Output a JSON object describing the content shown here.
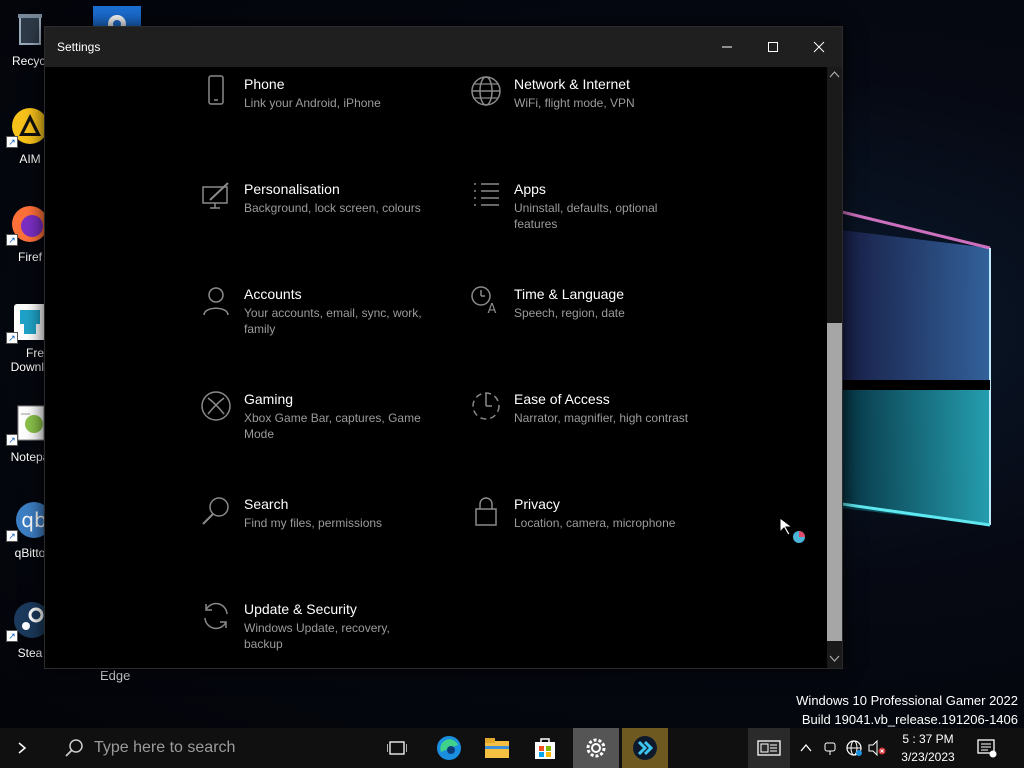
{
  "desktop": {
    "icons": [
      {
        "label": "Recycl",
        "color": "#2e3a48"
      },
      {
        "label": "AIM",
        "color": "#f7c21a"
      },
      {
        "label": "Firef",
        "color": "#ff7139"
      },
      {
        "label": "Fre",
        "label2": "Downl",
        "color": "#1fa3c8"
      },
      {
        "label": "Notepa",
        "color": "#8bc34a"
      },
      {
        "label": "qBitto",
        "color": "#3d7fc4"
      },
      {
        "label": "Stea",
        "color": "#1b3a5c"
      }
    ],
    "edge_label": "Edge",
    "watermark_line1": "Windows 10 Professional Gamer 2022",
    "watermark_line2": "Build 19041.vb_release.191206-1406"
  },
  "window": {
    "title": "Settings",
    "minimize_icon": "minimize-icon",
    "maximize_icon": "maximize-icon",
    "close_icon": "close-icon"
  },
  "settings": {
    "tiles": [
      {
        "name": "Phone",
        "desc": "Link your Android, iPhone",
        "icon": "phone-icon"
      },
      {
        "name": "Network & Internet",
        "desc": "WiFi, flight mode, VPN",
        "icon": "globe-icon"
      },
      {
        "name": "Personalisation",
        "desc": "Background, lock screen, colours",
        "icon": "paint-icon"
      },
      {
        "name": "Apps",
        "desc": "Uninstall, defaults, optional features",
        "icon": "apps-list-icon"
      },
      {
        "name": "Accounts",
        "desc": "Your accounts, email, sync, work, family",
        "icon": "person-icon"
      },
      {
        "name": "Time & Language",
        "desc": "Speech, region, date",
        "icon": "time-language-icon"
      },
      {
        "name": "Gaming",
        "desc": "Xbox Game Bar, captures, Game Mode",
        "icon": "xbox-icon"
      },
      {
        "name": "Ease of Access",
        "desc": "Narrator, magnifier, high contrast",
        "icon": "ease-of-access-icon"
      },
      {
        "name": "Search",
        "desc": "Find my files, permissions",
        "icon": "search-icon"
      },
      {
        "name": "Privacy",
        "desc": "Location, camera, microphone",
        "icon": "lock-icon"
      },
      {
        "name": "Update & Security",
        "desc": "Windows Update, recovery, backup",
        "icon": "refresh-icon"
      }
    ]
  },
  "taskbar": {
    "search_placeholder": "Type here to search",
    "time": "5 : 37 PM",
    "date": "3/23/2023",
    "apps": [
      "task-view-icon",
      "edge-icon",
      "file-explorer-icon",
      "store-icon",
      "settings-gear-icon",
      "media-app-icon"
    ]
  }
}
